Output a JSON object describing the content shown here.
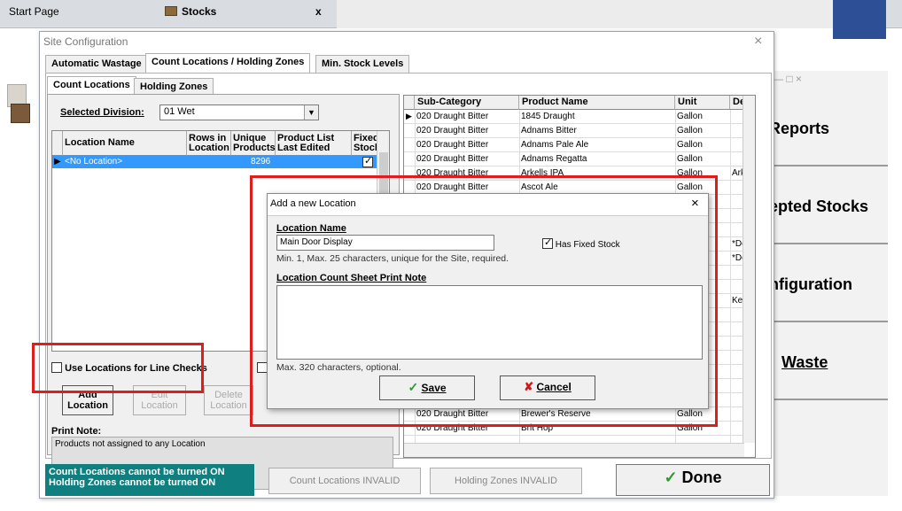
{
  "topbar": {
    "start_tab": "Start Page",
    "stocks_tab": "Stocks",
    "close_glyph": "x"
  },
  "background_app": {
    "window_controls": "—        □        ×",
    "buttons": [
      "Reports",
      "epted Stocks",
      "nfiguration",
      "Waste"
    ]
  },
  "window": {
    "title": "Site Configuration",
    "close_glyph": "×",
    "tabs": [
      "Automatic Wastage",
      "Count Locations / Holding Zones",
      "Min. Stock Levels"
    ],
    "inner_tabs": [
      "Count Locations",
      "Holding Zones"
    ]
  },
  "division": {
    "label": "Selected Division:",
    "value": "01 Wet"
  },
  "location_grid": {
    "columns": [
      "Location Name",
      "Rows in Location",
      "Unique Products",
      "Product List Last Edited",
      "Fixed Stock"
    ],
    "rows": [
      {
        "name": "<No Location>",
        "rows": "",
        "unique": "8296",
        "edited": "",
        "fixed": true
      }
    ]
  },
  "line_checks_label": "Use Locations for Line Checks",
  "buttons": {
    "add_line1": "Add",
    "add_line2": "Location",
    "edit_line1": "Edit",
    "edit_line2": "Location",
    "delete_line1": "Delete",
    "delete_line2": "Location"
  },
  "print_note": {
    "label": "Print Note:",
    "text": "Products not assigned to any Location"
  },
  "product_grid": {
    "columns": [
      "Sub-Category",
      "Product Name",
      "Unit",
      "Des"
    ],
    "rows": [
      {
        "sub": "020 Draught Bitter",
        "name": "1845 Draught",
        "unit": "Gallon",
        "desc": ""
      },
      {
        "sub": "020 Draught Bitter",
        "name": "Adnams Bitter",
        "unit": "Gallon",
        "desc": ""
      },
      {
        "sub": "020 Draught Bitter",
        "name": "Adnams Pale Ale",
        "unit": "Gallon",
        "desc": ""
      },
      {
        "sub": "020 Draught Bitter",
        "name": "Adnams Regatta",
        "unit": "Gallon",
        "desc": ""
      },
      {
        "sub": "020 Draught Bitter",
        "name": "Arkells IPA",
        "unit": "Gallon",
        "desc": "Arke"
      },
      {
        "sub": "020 Draught Bitter",
        "name": "Ascot Ale",
        "unit": "Gallon",
        "desc": ""
      },
      {
        "sub": "",
        "name": "",
        "unit": "",
        "desc": ""
      },
      {
        "sub": "",
        "name": "",
        "unit": "",
        "desc": ""
      },
      {
        "sub": "",
        "name": "",
        "unit": "",
        "desc": ""
      },
      {
        "sub": "",
        "name": "",
        "unit": "",
        "desc": "*Del"
      },
      {
        "sub": "",
        "name": "",
        "unit": "",
        "desc": "*Del"
      },
      {
        "sub": "",
        "name": "",
        "unit": "",
        "desc": ""
      },
      {
        "sub": "",
        "name": "",
        "unit": "",
        "desc": ""
      },
      {
        "sub": "",
        "name": "",
        "unit": "",
        "desc": "Keg"
      },
      {
        "sub": "",
        "name": "",
        "unit": "",
        "desc": ""
      },
      {
        "sub": "",
        "name": "",
        "unit": "",
        "desc": ""
      },
      {
        "sub": "",
        "name": "",
        "unit": "",
        "desc": ""
      },
      {
        "sub": "",
        "name": "",
        "unit": "",
        "desc": ""
      },
      {
        "sub": "",
        "name": "",
        "unit": "",
        "desc": ""
      },
      {
        "sub": "",
        "name": "",
        "unit": "",
        "desc": ""
      },
      {
        "sub": "",
        "name": "",
        "unit": "",
        "desc": ""
      },
      {
        "sub": "020 Draught Bitter",
        "name": "Brewer's Reserve",
        "unit": "Gallon",
        "desc": ""
      },
      {
        "sub": "020 Draught Bitter",
        "name": "Brit Hop",
        "unit": "Gallon",
        "desc": ""
      }
    ]
  },
  "status": {
    "line1": "Count Locations cannot be turned ON",
    "line2": "Holding Zones cannot be turned ON",
    "count_invalid": "Count Locations INVALID",
    "holding_invalid": "Holding Zones INVALID",
    "done": "Done"
  },
  "dialog": {
    "title": "Add a new Location",
    "close_glyph": "×",
    "location_name_label": "Location Name",
    "location_name_value": "Main Door Display",
    "fixed_stock_label": "Has Fixed Stock",
    "fixed_stock_checked": true,
    "name_hint": "Min. 1, Max. 25 characters, unique for the Site, required.",
    "print_note_label": "Location Count Sheet Print Note",
    "print_note_value": "",
    "print_note_hint": "Max. 320 characters, optional.",
    "save": "Save",
    "cancel": "Cancel"
  },
  "colors": {
    "highlight": "#e01c1c",
    "selection": "#3399ff",
    "status_teal": "#0f7f7f",
    "accent_green": "#2c9b2c"
  }
}
